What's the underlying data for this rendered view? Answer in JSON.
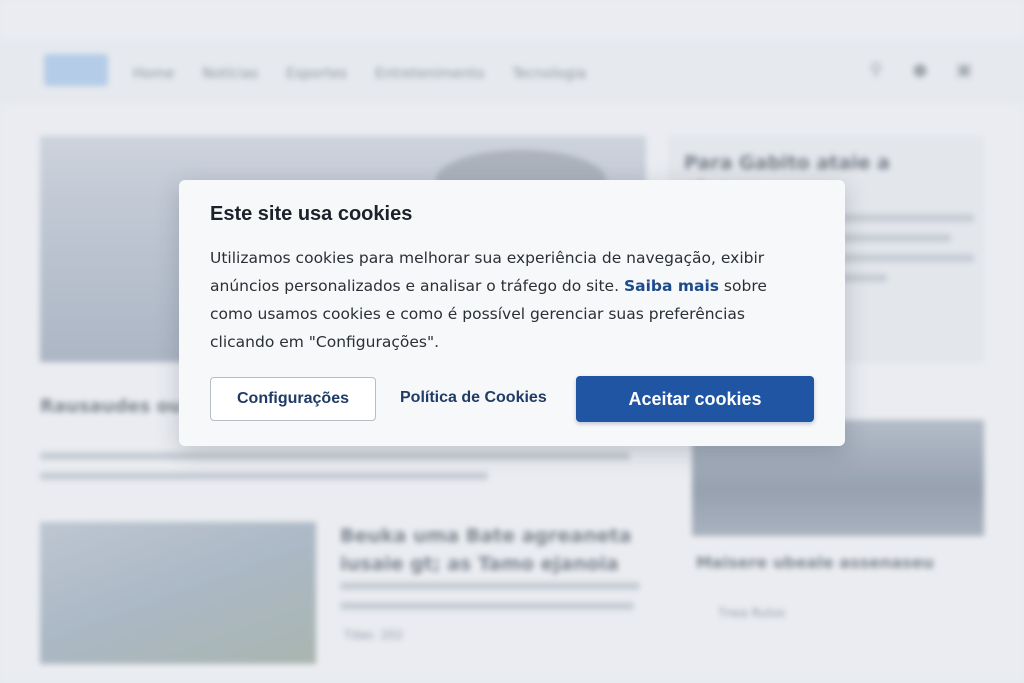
{
  "background": {
    "nav": [
      "Home",
      "Notícias",
      "Esportes",
      "Entretenimento",
      "Tecnologia"
    ],
    "icons": [
      "search-icon",
      "user-icon",
      "share-icon"
    ],
    "side_card_title": "Para Gabito ataie a plenere",
    "article1_title": "Rausaudes ou paraezoas ei",
    "article2_title": "Beuka uma Bate agreaneta iusaie gt; as Tamo ejanoia",
    "article2_meta": "Tdas: 202",
    "article3_title": "Maisere ubeale assenaseu",
    "article3_meta": "Tnea Rutos"
  },
  "dialog": {
    "title": "Este site usa cookies",
    "body_part1": "Utilizamos cookies para melhorar sua experiência de navegação, exibir anúncios personalizados e analisar o tráfego do site. ",
    "body_link": "Saiba mais",
    "body_part2": " sobre como usamos cookies e como é possível gerenciar suas preferências clicando em \"Configurações\".",
    "btn_config": "Configurações",
    "link_policy": "Política de Cookies",
    "btn_accept": "Aceitar cookies"
  },
  "colors": {
    "accent": "#1f55a3",
    "link": "#1c4a8a",
    "dialog_bg": "#f7f8fa"
  }
}
